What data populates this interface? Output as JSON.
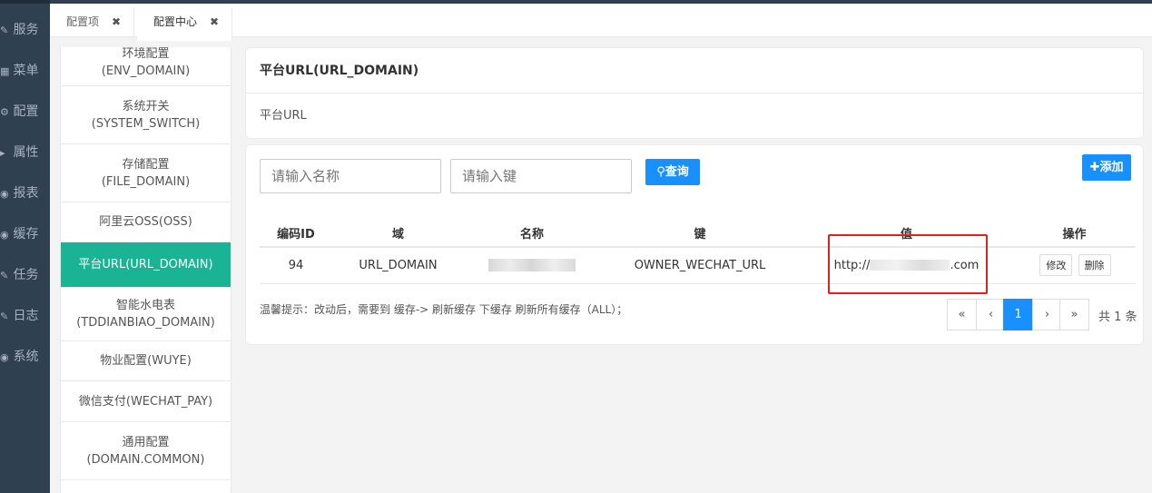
{
  "nav": [
    {
      "icon": "edit-icon",
      "glyph": "✎",
      "label": "服务"
    },
    {
      "icon": "grid-icon",
      "glyph": "▦",
      "label": "菜单"
    },
    {
      "icon": "gear-icon",
      "glyph": "⚙",
      "label": "配置"
    },
    {
      "icon": "tag-icon",
      "glyph": "▸",
      "label": "属性"
    },
    {
      "icon": "chart-icon",
      "glyph": "◉",
      "label": "报表"
    },
    {
      "icon": "database-icon",
      "glyph": "◉",
      "label": "缓存"
    },
    {
      "icon": "task-icon",
      "glyph": "✎",
      "label": "任务"
    },
    {
      "icon": "log-icon",
      "glyph": "✎",
      "label": "日志"
    },
    {
      "icon": "system-icon",
      "glyph": "◉",
      "label": "系统"
    }
  ],
  "tabs": [
    {
      "label": "配置项",
      "close": "✖"
    },
    {
      "label": "配置中心",
      "close": "✖"
    }
  ],
  "config_list": [
    {
      "name": "环境配置",
      "code": "(ENV_DOMAIN)"
    },
    {
      "name": "系统开关",
      "code": "(SYSTEM_SWITCH)"
    },
    {
      "name": "存储配置",
      "code": "(FILE_DOMAIN)"
    },
    {
      "name": "阿里云OSS(OSS)",
      "code": ""
    },
    {
      "name": "平台URL(URL_DOMAIN)",
      "code": ""
    },
    {
      "name": "智能水电表",
      "code": "(TDDIANBIAO_DOMAIN)"
    },
    {
      "name": "物业配置(WUYE)",
      "code": ""
    },
    {
      "name": "微信支付(WECHAT_PAY)",
      "code": ""
    },
    {
      "name": "通用配置",
      "code": "(DOMAIN.COMMON)"
    }
  ],
  "detail": {
    "title": "平台URL(URL_DOMAIN)",
    "description": "平台URL"
  },
  "search": {
    "name_placeholder": "请输入名称",
    "key_placeholder": "请输入键",
    "query_label": "查询",
    "add_label": "添加"
  },
  "table": {
    "headers": [
      "编码ID",
      "域",
      "名称",
      "键",
      "值",
      "操作"
    ],
    "rows": [
      {
        "id": "94",
        "domain": "URL_DOMAIN",
        "name": "",
        "key": "OWNER_WECHAT_URL",
        "value_prefix": "http://",
        "value_suffix": ".com",
        "edit": "修改",
        "delete": "删除"
      }
    ]
  },
  "tip": "温馨提示：改动后，需要到 缓存-> 刷新缓存 下缓存 刷新所有缓存（ALL）；",
  "pagination": {
    "first": "«",
    "prev": "‹",
    "current": "1",
    "next": "›",
    "last": "»",
    "total": "共 1 条"
  },
  "colors": {
    "nav_bg": "#2f4050",
    "active_green": "#1ab394",
    "primary_blue": "#1890ff",
    "highlight_red": "#e02020"
  }
}
